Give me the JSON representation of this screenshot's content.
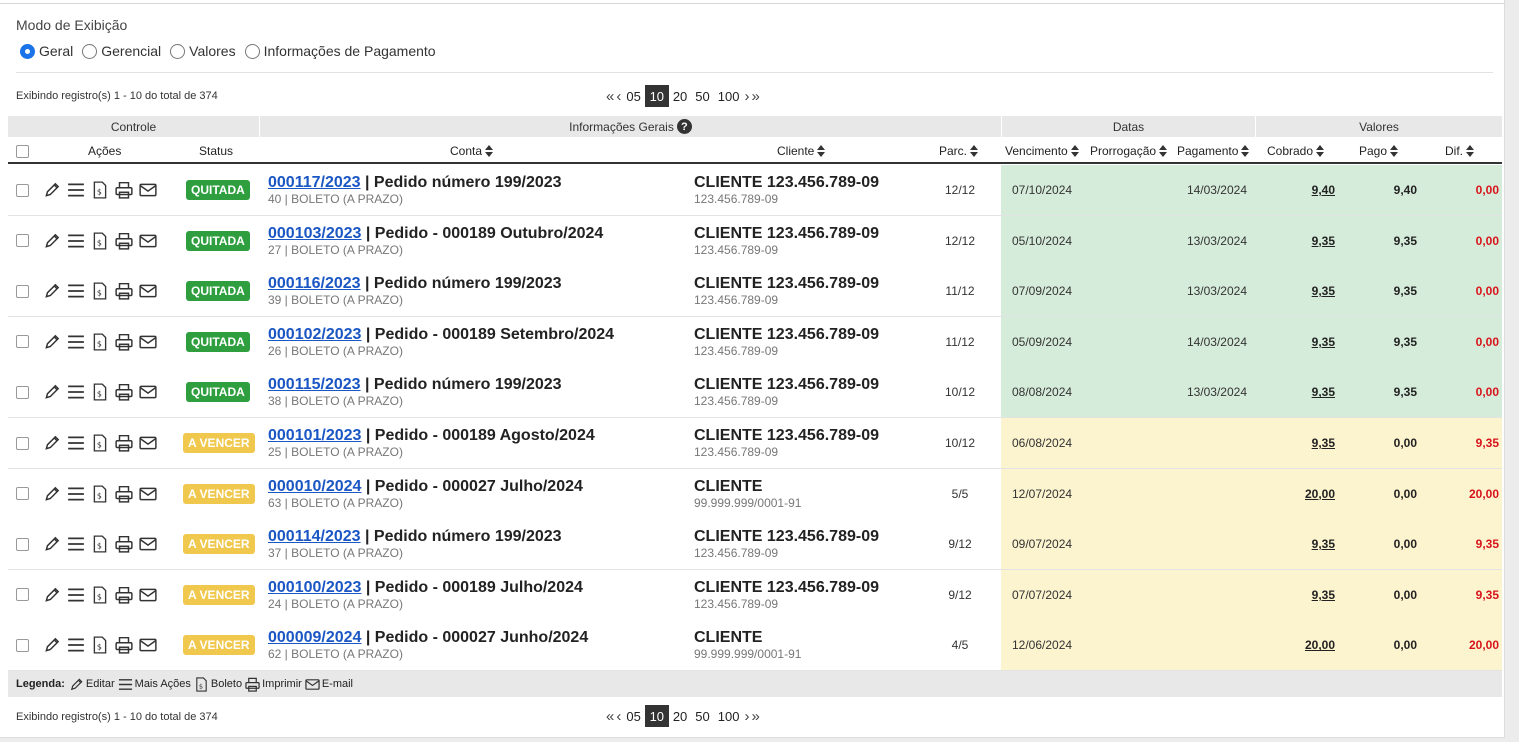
{
  "view_mode": {
    "title": "Modo de Exibição",
    "options": [
      "Geral",
      "Gerencial",
      "Valores",
      "Informações de Pagamento"
    ],
    "selected": "Geral"
  },
  "pagination": {
    "info": "Exibindo registro(s) 1 - 10 do total de 374",
    "sizes": [
      "05",
      "10",
      "20",
      "50",
      "100"
    ],
    "active": "10"
  },
  "groups": {
    "controle": "Controle",
    "informacoes": "Informações Gerais",
    "datas": "Datas",
    "valores": "Valores"
  },
  "columns": {
    "acoes": "Ações",
    "status": "Status",
    "conta": "Conta",
    "cliente": "Cliente",
    "parc": "Parc.",
    "vencimento": "Vencimento",
    "prorrogacao": "Prorrogação",
    "pagamento": "Pagamento",
    "cobrado": "Cobrado",
    "pago": "Pago",
    "dif": "Dif."
  },
  "rows": [
    {
      "status": "QUITADA",
      "state": "paid",
      "conta_link": "000117/2023",
      "conta_desc": " | Pedido número 199/2023",
      "conta_sub": "40 | BOLETO (A PRAZO)",
      "cliente": "CLIENTE 123.456.789-09",
      "doc": "123.456.789-09",
      "parc": "12/12",
      "venc": "07/10/2024",
      "prorrog": "",
      "pagto": "14/03/2024",
      "cobrado": "9,40",
      "pago": "9,40",
      "dif": "0,00"
    },
    {
      "status": "QUITADA",
      "state": "paid",
      "conta_link": "000103/2023",
      "conta_desc": " | Pedido - 000189 Outubro/2024",
      "conta_sub": "27 | BOLETO (A PRAZO)",
      "cliente": "CLIENTE 123.456.789-09",
      "doc": "123.456.789-09",
      "parc": "12/12",
      "venc": "05/10/2024",
      "prorrog": "",
      "pagto": "13/03/2024",
      "cobrado": "9,35",
      "pago": "9,35",
      "dif": "0,00"
    },
    {
      "status": "QUITADA",
      "state": "paid",
      "conta_link": "000116/2023",
      "conta_desc": " | Pedido número 199/2023",
      "conta_sub": "39 | BOLETO (A PRAZO)",
      "cliente": "CLIENTE 123.456.789-09",
      "doc": "123.456.789-09",
      "parc": "11/12",
      "venc": "07/09/2024",
      "prorrog": "",
      "pagto": "13/03/2024",
      "cobrado": "9,35",
      "pago": "9,35",
      "dif": "0,00"
    },
    {
      "status": "QUITADA",
      "state": "paid",
      "conta_link": "000102/2023",
      "conta_desc": " | Pedido - 000189 Setembro/2024",
      "conta_sub": "26 | BOLETO (A PRAZO)",
      "cliente": "CLIENTE 123.456.789-09",
      "doc": "123.456.789-09",
      "parc": "11/12",
      "venc": "05/09/2024",
      "prorrog": "",
      "pagto": "14/03/2024",
      "cobrado": "9,35",
      "pago": "9,35",
      "dif": "0,00"
    },
    {
      "status": "QUITADA",
      "state": "paid",
      "conta_link": "000115/2023",
      "conta_desc": " | Pedido número 199/2023",
      "conta_sub": "38 | BOLETO (A PRAZO)",
      "cliente": "CLIENTE 123.456.789-09",
      "doc": "123.456.789-09",
      "parc": "10/12",
      "venc": "08/08/2024",
      "prorrog": "",
      "pagto": "13/03/2024",
      "cobrado": "9,35",
      "pago": "9,35",
      "dif": "0,00"
    },
    {
      "status": "A VENCER",
      "state": "open",
      "conta_link": "000101/2023",
      "conta_desc": " | Pedido - 000189 Agosto/2024",
      "conta_sub": "25 | BOLETO (A PRAZO)",
      "cliente": "CLIENTE 123.456.789-09",
      "doc": "123.456.789-09",
      "parc": "10/12",
      "venc": "06/08/2024",
      "prorrog": "",
      "pagto": "",
      "cobrado": "9,35",
      "pago": "0,00",
      "dif": "9,35"
    },
    {
      "status": "A VENCER",
      "state": "open",
      "conta_link": "000010/2024",
      "conta_desc": " | Pedido - 000027 Julho/2024",
      "conta_sub": "63 | BOLETO (A PRAZO)",
      "cliente": "CLIENTE",
      "doc": "99.999.999/0001-91",
      "parc": "5/5",
      "venc": "12/07/2024",
      "prorrog": "",
      "pagto": "",
      "cobrado": "20,00",
      "pago": "0,00",
      "dif": "20,00"
    },
    {
      "status": "A VENCER",
      "state": "open",
      "conta_link": "000114/2023",
      "conta_desc": " | Pedido número 199/2023",
      "conta_sub": "37 | BOLETO (A PRAZO)",
      "cliente": "CLIENTE 123.456.789-09",
      "doc": "123.456.789-09",
      "parc": "9/12",
      "venc": "09/07/2024",
      "prorrog": "",
      "pagto": "",
      "cobrado": "9,35",
      "pago": "0,00",
      "dif": "9,35"
    },
    {
      "status": "A VENCER",
      "state": "open",
      "conta_link": "000100/2023",
      "conta_desc": " | Pedido - 000189 Julho/2024",
      "conta_sub": "24 | BOLETO (A PRAZO)",
      "cliente": "CLIENTE 123.456.789-09",
      "doc": "123.456.789-09",
      "parc": "9/12",
      "venc": "07/07/2024",
      "prorrog": "",
      "pagto": "",
      "cobrado": "9,35",
      "pago": "0,00",
      "dif": "9,35"
    },
    {
      "status": "A VENCER",
      "state": "open",
      "conta_link": "000009/2024",
      "conta_desc": " | Pedido - 000027 Junho/2024",
      "conta_sub": "62 | BOLETO (A PRAZO)",
      "cliente": "CLIENTE",
      "doc": "99.999.999/0001-91",
      "parc": "4/5",
      "venc": "12/06/2024",
      "prorrog": "",
      "pagto": "",
      "cobrado": "20,00",
      "pago": "0,00",
      "dif": "20,00"
    }
  ],
  "legend": {
    "label": "Legenda:",
    "items": [
      {
        "icon": "pencil-icon",
        "text": "Editar"
      },
      {
        "icon": "menu-icon",
        "text": "Mais Ações"
      },
      {
        "icon": "boleto-icon",
        "text": "Boleto"
      },
      {
        "icon": "printer-icon",
        "text": "Imprimir"
      },
      {
        "icon": "envelope-icon",
        "text": "E-mail"
      }
    ]
  },
  "colors": {
    "paid_row": "#d6ecda",
    "open_row": "#fcf3cf",
    "badge_paid": "#2e9e3f",
    "badge_open": "#f0c84d",
    "link": "#1a56c4",
    "diff": "#d8141b"
  }
}
